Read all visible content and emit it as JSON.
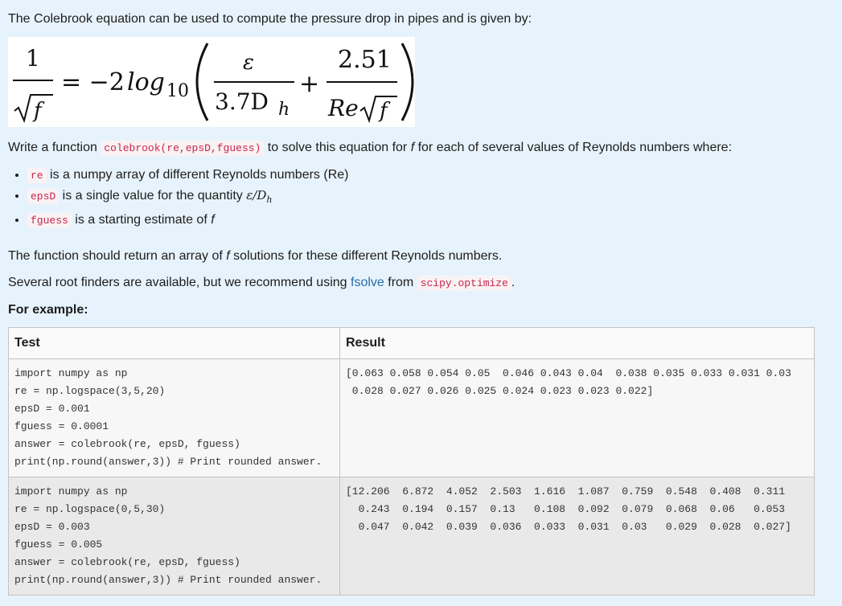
{
  "intro": "The Colebrook equation can be used to compute the pressure drop in pipes and is given by:",
  "formula": {
    "lhs_num": "1",
    "lhs_den": "f",
    "equals": "= −2",
    "log": "log",
    "log_sub": "10",
    "frac1_num": "ε",
    "frac1_den_main": "3.7D",
    "frac1_den_sub": "h",
    "plus": "+",
    "frac2_num": "2.51",
    "frac2_den": "Re",
    "frac2_den_root": "f"
  },
  "write_line": {
    "before": "Write a function ",
    "code": "colebrook(re,epsD,fguess)",
    "middle": " to solve this equation for ",
    "var": "f",
    "after": " for each of several values of Reynolds numbers where:"
  },
  "bullets": [
    {
      "code": "re",
      "text": " is a numpy array of different Reynolds numbers (Re)"
    },
    {
      "code": "epsD",
      "text": " is a single value for the quantity ",
      "math": "ε/D",
      "math_sub": "h"
    },
    {
      "code": "fguess",
      "text": " is a starting estimate of ",
      "var": "f"
    }
  ],
  "return_line": {
    "before": "The function should return an array of ",
    "var": "f",
    "after": " solutions for these different Reynolds numbers."
  },
  "root_line": {
    "before": "Several root finders are available, but we recommend using ",
    "link": "fsolve",
    "middle": " from ",
    "code": "scipy.optimize",
    "after": "."
  },
  "example_label": "For example:",
  "table": {
    "headers": [
      "Test",
      "Result"
    ],
    "rows": [
      {
        "test": "import numpy as np\nre = np.logspace(3,5,20)\nepsD = 0.001\nfguess = 0.0001\nanswer = colebrook(re, epsD, fguess)\nprint(np.round(answer,3)) # Print rounded answer.",
        "result": "[0.063 0.058 0.054 0.05  0.046 0.043 0.04  0.038 0.035 0.033 0.031 0.03\n 0.028 0.027 0.026 0.025 0.024 0.023 0.023 0.022]"
      },
      {
        "test": "import numpy as np\nre = np.logspace(0,5,30)\nepsD = 0.003\nfguess = 0.005\nanswer = colebrook(re, epsD, fguess)\nprint(np.round(answer,3)) # Print rounded answer.",
        "result": "[12.206  6.872  4.052  2.503  1.616  1.087  0.759  0.548  0.408  0.311\n  0.243  0.194  0.157  0.13   0.108  0.092  0.079  0.068  0.06   0.053\n  0.047  0.042  0.039  0.036  0.033  0.031  0.03   0.029  0.028  0.027]"
      }
    ]
  }
}
